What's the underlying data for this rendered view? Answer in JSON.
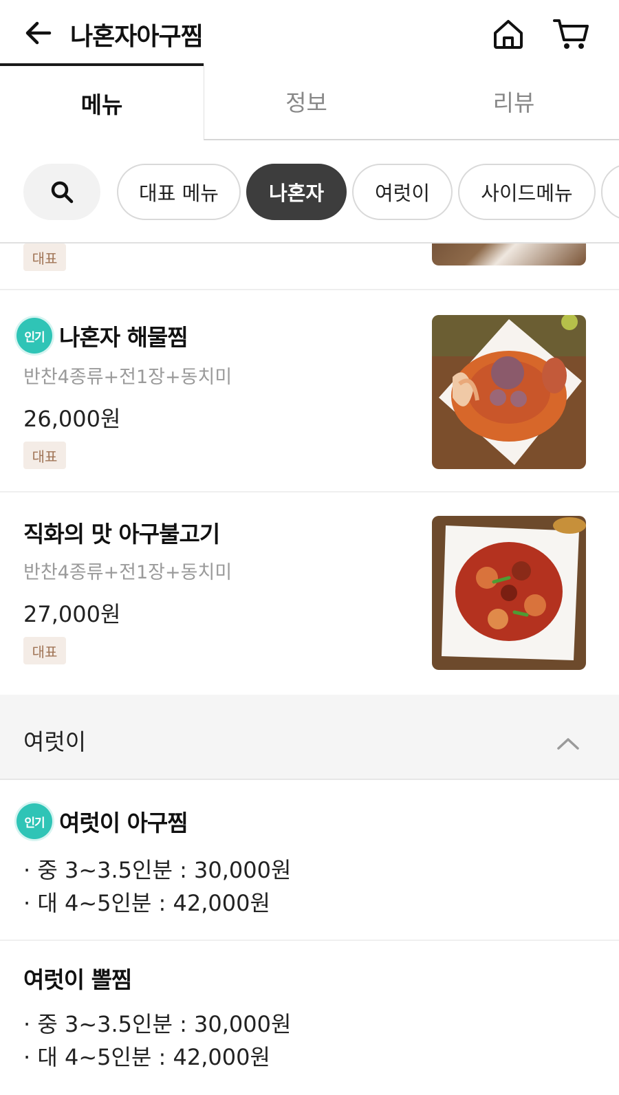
{
  "header": {
    "title": "나혼자아구찜",
    "back_icon": "arrow-left-icon",
    "home_icon": "home-icon",
    "cart_icon": "cart-icon"
  },
  "tabs": [
    {
      "label": "메뉴",
      "active": true
    },
    {
      "label": "정보",
      "active": false
    },
    {
      "label": "리뷰",
      "active": false
    }
  ],
  "chips": {
    "search_icon": "search-icon",
    "items": [
      {
        "label": "대표 메뉴",
        "active": false
      },
      {
        "label": "나혼자",
        "active": true
      },
      {
        "label": "여럿이",
        "active": false
      },
      {
        "label": "사이드메뉴",
        "active": false
      }
    ]
  },
  "partial_item": {
    "tag": "대표"
  },
  "items": [
    {
      "badge": "인기",
      "name": "나혼자 해물찜",
      "desc": "반찬4종류+전1장+동치미",
      "price": "26,000원",
      "tag": "대표"
    },
    {
      "name": "직화의 맛 아구불고기",
      "desc": "반찬4종류+전1장+동치미",
      "price": "27,000원",
      "tag": "대표"
    }
  ],
  "section": {
    "title": "여럿이",
    "icon": "chevron-up-icon"
  },
  "group_items": [
    {
      "badge": "인기",
      "name": "여럿이 아구찜",
      "options": [
        "· 중 3~3.5인분 : 30,000원",
        "· 대 4~5인분 : 42,000원"
      ]
    },
    {
      "name": "여럿이 뽈찜",
      "options": [
        "· 중 3~3.5인분 : 30,000원",
        "· 대 4~5인분 : 42,000원"
      ]
    }
  ],
  "colors": {
    "accent_dark": "#3d3d3d",
    "badge_teal": "#2fc4b6",
    "tag_bg": "#f4ece6",
    "tag_text": "#a07456"
  }
}
